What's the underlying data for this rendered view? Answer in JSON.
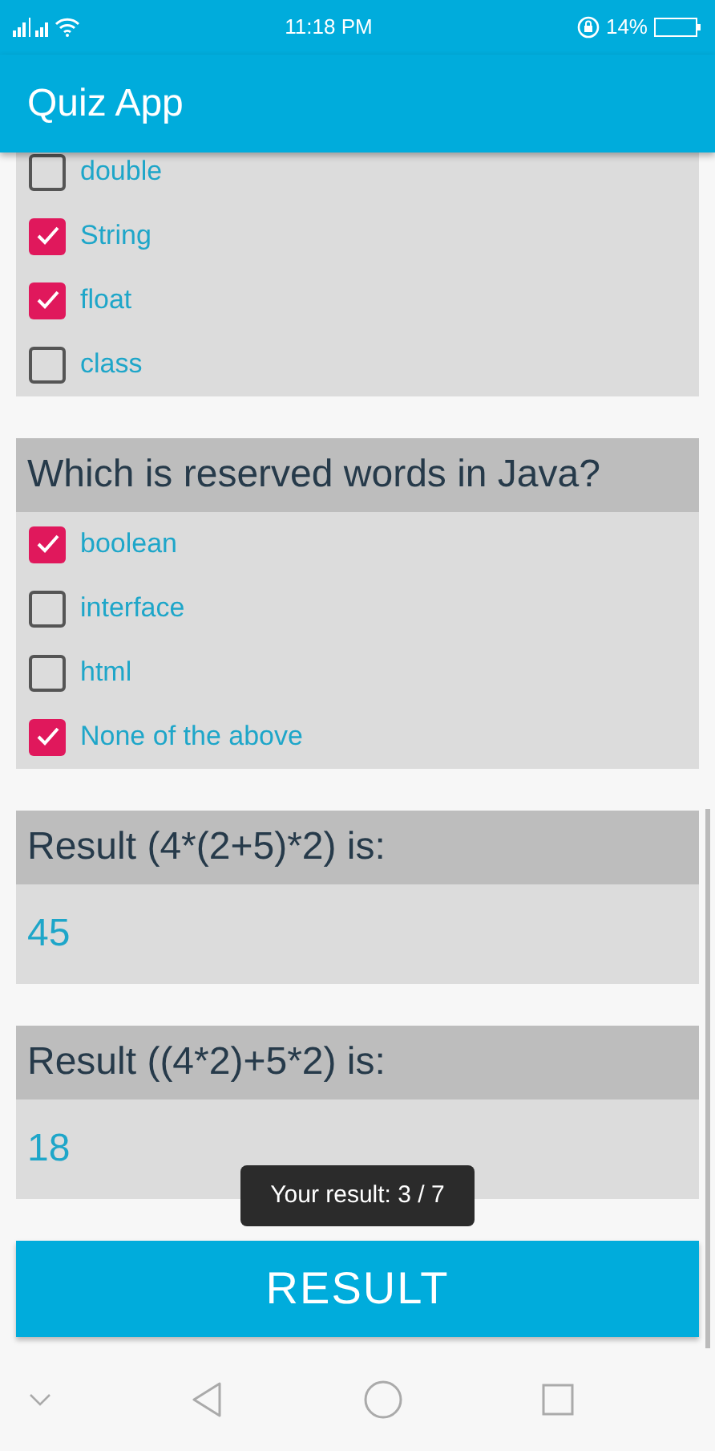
{
  "status_bar": {
    "time": "11:18 PM",
    "battery": "14%"
  },
  "app_bar": {
    "title": "Quiz App"
  },
  "questions": [
    {
      "options": [
        {
          "label": "double",
          "checked": false
        },
        {
          "label": "String",
          "checked": true
        },
        {
          "label": "float",
          "checked": true
        },
        {
          "label": "class",
          "checked": false
        }
      ]
    },
    {
      "question": "Which is reserved words in Java?",
      "options": [
        {
          "label": "boolean",
          "checked": true
        },
        {
          "label": "interface",
          "checked": false
        },
        {
          "label": "html",
          "checked": false
        },
        {
          "label": "None of the above",
          "checked": true
        }
      ]
    }
  ],
  "results": [
    {
      "label": "Result (4*(2+5)*2) is:",
      "value": "45"
    },
    {
      "label": "Result ((4*2)+5*2) is:",
      "value": "18"
    }
  ],
  "button": "RESULT",
  "toast": "Your result: 3 / 7"
}
